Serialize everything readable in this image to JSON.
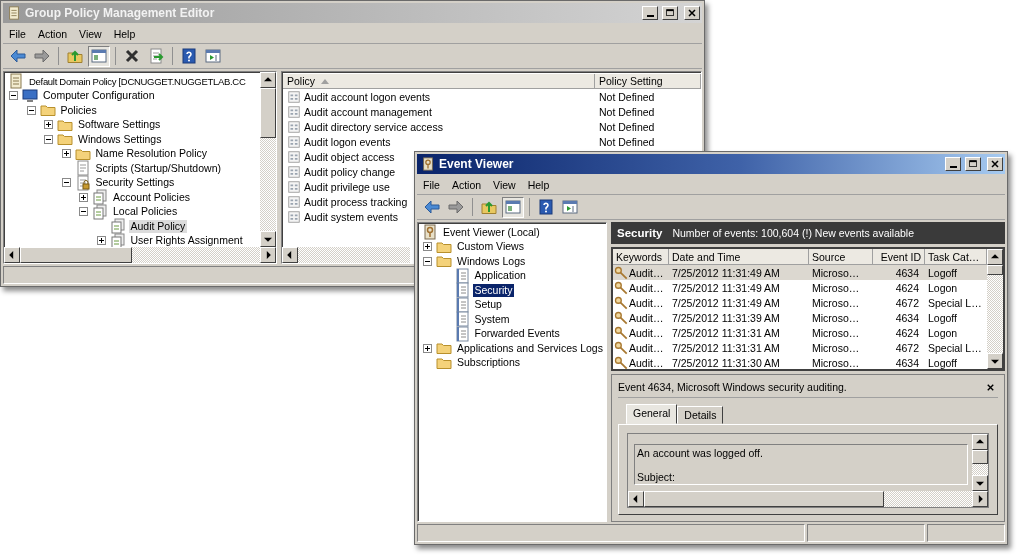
{
  "gpme": {
    "title": "Group Policy Management Editor",
    "active": false,
    "menu": [
      "File",
      "Action",
      "View",
      "Help"
    ],
    "toolbar": [
      {
        "kind": "back"
      },
      {
        "kind": "forward"
      },
      {
        "kind": "sep"
      },
      {
        "kind": "up"
      },
      {
        "kind": "pane",
        "pressed": true
      },
      {
        "kind": "sep"
      },
      {
        "kind": "delete"
      },
      {
        "kind": "export"
      },
      {
        "kind": "sep"
      },
      {
        "kind": "help"
      },
      {
        "kind": "console"
      }
    ],
    "tree": [
      {
        "label": "Default Domain Policy [DCNUGGET.NUGGETLAB.CC",
        "kind": "scroll",
        "selected": false,
        "children": [
          {
            "label": "Computer Configuration",
            "kind": "computer",
            "selected": false,
            "expanded": true,
            "children": [
              {
                "label": "Policies",
                "kind": "folder",
                "selected": false,
                "expanded": true,
                "children": [
                  {
                    "label": "Software Settings",
                    "kind": "folder",
                    "selected": false,
                    "expanded": false
                  },
                  {
                    "label": "Windows Settings",
                    "kind": "folder",
                    "selected": false,
                    "expanded": true,
                    "children": [
                      {
                        "label": "Name Resolution Policy",
                        "kind": "folder",
                        "selected": false,
                        "expanded": false
                      },
                      {
                        "label": "Scripts (Startup/Shutdown)",
                        "kind": "doc",
                        "selected": false
                      },
                      {
                        "label": "Security Settings",
                        "kind": "lockdoc",
                        "selected": false,
                        "expanded": true,
                        "children": [
                          {
                            "label": "Account Policies",
                            "kind": "policy",
                            "selected": false,
                            "expanded": false
                          },
                          {
                            "label": "Local Policies",
                            "kind": "policy",
                            "selected": false,
                            "expanded": true,
                            "children": [
                              {
                                "label": "Audit Policy",
                                "kind": "policy",
                                "selected": true
                              },
                              {
                                "label": "User Rights Assignment",
                                "kind": "policy",
                                "selected": false,
                                "expanded": false
                              }
                            ]
                          }
                        ]
                      }
                    ]
                  }
                ]
              }
            ]
          }
        ]
      }
    ],
    "columns": [
      {
        "label": "Policy",
        "sorted": true
      },
      {
        "label": "Policy Setting",
        "sorted": false
      }
    ],
    "rows": [
      {
        "policy": "Audit account logon events",
        "setting": "Not Defined"
      },
      {
        "policy": "Audit account management",
        "setting": "Not Defined"
      },
      {
        "policy": "Audit directory service access",
        "setting": "Not Defined"
      },
      {
        "policy": "Audit logon events",
        "setting": "Not Defined"
      },
      {
        "policy": "Audit object access"
      },
      {
        "policy": "Audit policy change"
      },
      {
        "policy": "Audit privilege use"
      },
      {
        "policy": "Audit process tracking"
      },
      {
        "policy": "Audit system events"
      }
    ]
  },
  "ev": {
    "title": "Event Viewer",
    "active": true,
    "menu": [
      "File",
      "Action",
      "View",
      "Help"
    ],
    "toolbar": [
      {
        "kind": "back"
      },
      {
        "kind": "forward"
      },
      {
        "kind": "sep"
      },
      {
        "kind": "up"
      },
      {
        "kind": "pane",
        "pressed": true
      },
      {
        "kind": "sep"
      },
      {
        "kind": "help"
      },
      {
        "kind": "console"
      }
    ],
    "tree": [
      {
        "label": "Event Viewer (Local)",
        "kind": "viewer",
        "selected": false,
        "children": [
          {
            "label": "Custom Views",
            "kind": "folder",
            "selected": false,
            "expanded": false
          },
          {
            "label": "Windows Logs",
            "kind": "folder",
            "selected": false,
            "expanded": true,
            "children": [
              {
                "label": "Application",
                "kind": "log",
                "selected": false
              },
              {
                "label": "Security",
                "kind": "log",
                "selected": true
              },
              {
                "label": "Setup",
                "kind": "log",
                "selected": false
              },
              {
                "label": "System",
                "kind": "log",
                "selected": false
              },
              {
                "label": "Forwarded Events",
                "kind": "log",
                "selected": false
              }
            ]
          },
          {
            "label": "Applications and Services Logs",
            "kind": "folder",
            "selected": false,
            "expanded": false
          },
          {
            "label": "Subscriptions",
            "kind": "folder",
            "selected": false
          }
        ]
      }
    ],
    "header": {
      "title": "Security",
      "info": "Number of events: 100,604 (!) New events available"
    },
    "columns": [
      "Keywords",
      "Date and Time",
      "Source",
      "Event ID",
      "Task Cat…"
    ],
    "rows": [
      {
        "keywords": "Audit…",
        "date": "7/25/2012 11:31:49 AM",
        "source": "Microso…",
        "id": "4634",
        "task": "Logoff",
        "selected": true
      },
      {
        "keywords": "Audit…",
        "date": "7/25/2012 11:31:49 AM",
        "source": "Microso…",
        "id": "4624",
        "task": "Logon",
        "selected": false
      },
      {
        "keywords": "Audit…",
        "date": "7/25/2012 11:31:49 AM",
        "source": "Microso…",
        "id": "4672",
        "task": "Special L…",
        "selected": false
      },
      {
        "keywords": "Audit…",
        "date": "7/25/2012 11:31:39 AM",
        "source": "Microso…",
        "id": "4634",
        "task": "Logoff",
        "selected": false
      },
      {
        "keywords": "Audit…",
        "date": "7/25/2012 11:31:31 AM",
        "source": "Microso…",
        "id": "4624",
        "task": "Logon",
        "selected": false
      },
      {
        "keywords": "Audit…",
        "date": "7/25/2012 11:31:31 AM",
        "source": "Microso…",
        "id": "4672",
        "task": "Special L…",
        "selected": false
      },
      {
        "keywords": "Audit…",
        "date": "7/25/2012 11:31:30 AM",
        "source": "Microso…",
        "id": "4634",
        "task": "Logoff",
        "selected": false
      }
    ],
    "detail": {
      "title": "Event 4634, Microsoft Windows security auditing.",
      "tabs": [
        {
          "label": "General",
          "selected": true
        },
        {
          "label": "Details",
          "selected": false
        }
      ],
      "lines": [
        "An account was logged off.",
        "Subject:"
      ]
    }
  }
}
